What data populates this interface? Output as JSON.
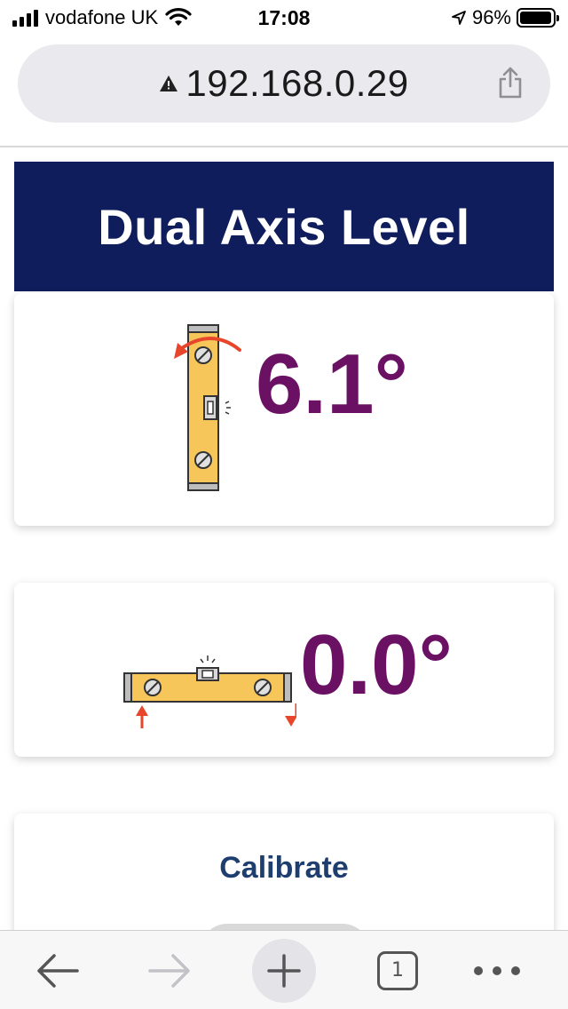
{
  "status_bar": {
    "carrier": "vodafone UK",
    "time": "17:08",
    "battery_percent": "96%",
    "battery_level": 0.96
  },
  "browser": {
    "url": "192.168.0.29",
    "open_tab_count": "1"
  },
  "page": {
    "title": "Dual Axis Level",
    "roll": {
      "value": "6.1°"
    },
    "pitch": {
      "value": "0.0°"
    },
    "calibrate": {
      "title": "Calibrate"
    }
  },
  "colors": {
    "header_background": "#0f1d5c",
    "value_text": "#6b1163",
    "calibrate_text": "#1d3e6e",
    "level_body": "#f6c65b",
    "arrow": "#e8462a"
  },
  "icons": {
    "roll": "vertical-spirit-level-rotate-icon",
    "pitch": "horizontal-spirit-level-tilt-icon",
    "back": "back-arrow-icon",
    "forward": "forward-arrow-icon",
    "new_tab": "plus-icon",
    "tabs": "tabs-icon",
    "more": "more-dots-icon",
    "share": "share-icon",
    "security": "warning-triangle-icon"
  }
}
